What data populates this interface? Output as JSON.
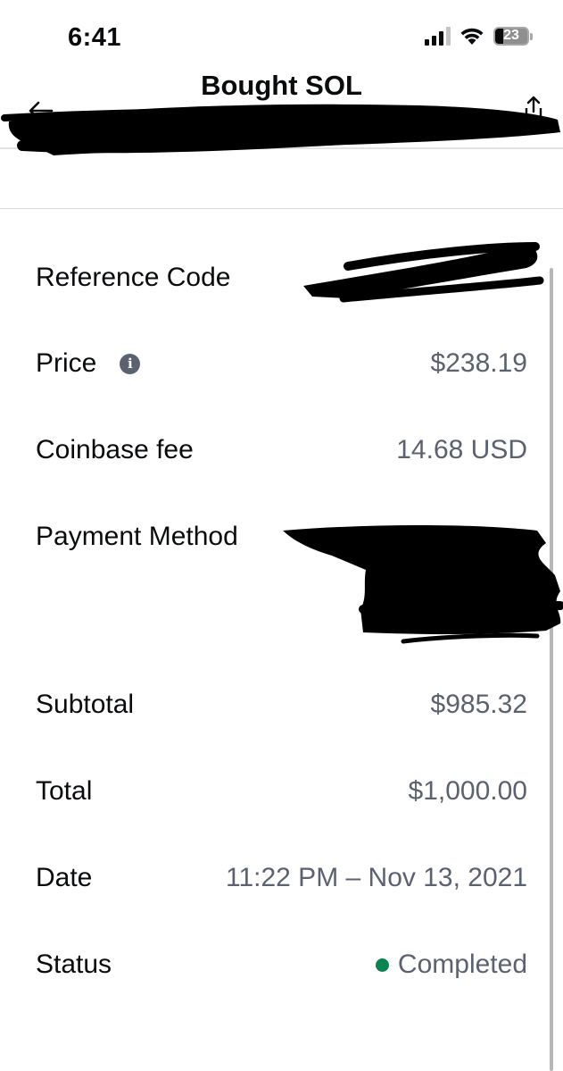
{
  "status_bar": {
    "time": "6:41",
    "battery_level": "23",
    "icons": [
      "cellular-signal-icon",
      "wifi-icon",
      "battery-icon"
    ]
  },
  "header": {
    "title": "Bought SOL",
    "back_icon": "arrow-left-icon",
    "share_icon": "share-icon"
  },
  "details": {
    "reference_code": {
      "label": "Reference Code",
      "value": ""
    },
    "price": {
      "label": "Price",
      "value": "$238.19",
      "icon": "info-icon"
    },
    "fee": {
      "label": "Coinbase fee",
      "value": "14.68 USD"
    },
    "payment_method": {
      "label": "Payment Method",
      "value": ""
    },
    "subtotal": {
      "label": "Subtotal",
      "value": "$985.32"
    },
    "total": {
      "label": "Total",
      "value": "$1,000.00"
    },
    "date": {
      "label": "Date",
      "value": "11:22 PM – Nov 13, 2021"
    },
    "status": {
      "label": "Status",
      "value": "Completed",
      "color": "#098551"
    }
  },
  "colors": {
    "text_primary": "#0a0b0d",
    "text_secondary": "#5b616e",
    "status_green": "#098551",
    "divider": "#d9dadd"
  }
}
